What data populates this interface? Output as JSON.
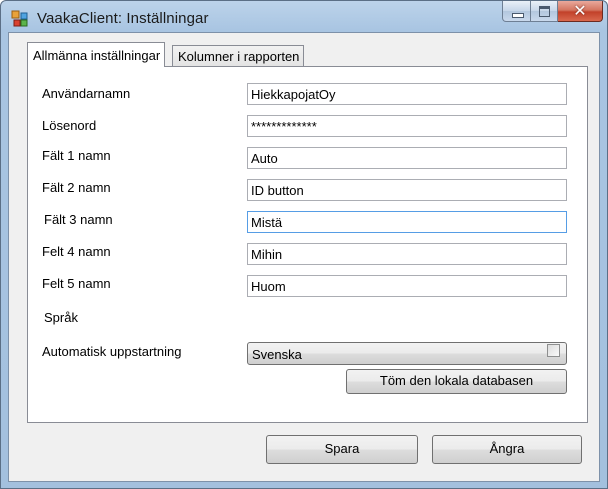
{
  "window": {
    "title": "VaakaClient: Inställningar",
    "caption": {
      "close_glyph": "✕"
    }
  },
  "tabs": [
    {
      "label": "Allmänna inställningar",
      "active": true
    },
    {
      "label": "Kolumner i rapporten",
      "active": false
    }
  ],
  "form": {
    "fields": [
      {
        "label": "Användarnamn",
        "value": "HiekkapojatOy"
      },
      {
        "label": "Lösenord",
        "value": "*************"
      },
      {
        "label": "Fält 1 namn",
        "value": "Auto"
      },
      {
        "label": "Fält 2 namn",
        "value": "ID button"
      },
      {
        "label": "Fält 3 namn",
        "value": "Mistä"
      },
      {
        "label": "Felt 4 namn",
        "value": "Mihin"
      },
      {
        "label": "Felt 5 namn",
        "value": "Huom"
      }
    ],
    "language": {
      "label": "Språk",
      "value": "Svenska"
    },
    "autostart": {
      "label": "Automatisk uppstartning",
      "checked": false
    },
    "clear_db_label": "Töm den lokala databasen"
  },
  "footer": {
    "save_label": "Spara",
    "undo_label": "Ångra"
  }
}
